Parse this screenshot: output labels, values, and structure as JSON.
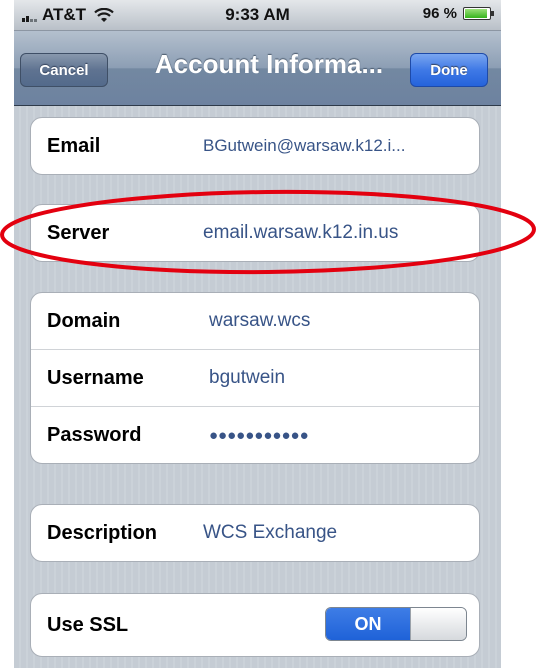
{
  "status_bar": {
    "carrier": "AT&T",
    "time": "9:33 AM",
    "battery": "96 %"
  },
  "nav": {
    "cancel_label": "Cancel",
    "title": "Account Informa...",
    "done_label": "Done"
  },
  "groups": {
    "email": {
      "label": "Email",
      "value": "BGutwein@warsaw.k12.i..."
    },
    "server": {
      "label": "Server",
      "value": "email.warsaw.k12.in.us"
    },
    "domain": {
      "label": "Domain",
      "value": "warsaw.wcs"
    },
    "username": {
      "label": "Username",
      "value": "bgutwein"
    },
    "password": {
      "label": "Password",
      "value": "●●●●●●●●●●●"
    },
    "description": {
      "label": "Description",
      "value": "WCS Exchange"
    },
    "ssl": {
      "label": "Use SSL",
      "toggle_label": "ON",
      "toggle_on": true
    }
  },
  "icons": [
    "signal-bars-icon",
    "wifi-icon",
    "battery-icon"
  ],
  "colors": {
    "accent": "#385487",
    "annotation": "#e3000f",
    "toggle_on": "#2a6ee0"
  }
}
